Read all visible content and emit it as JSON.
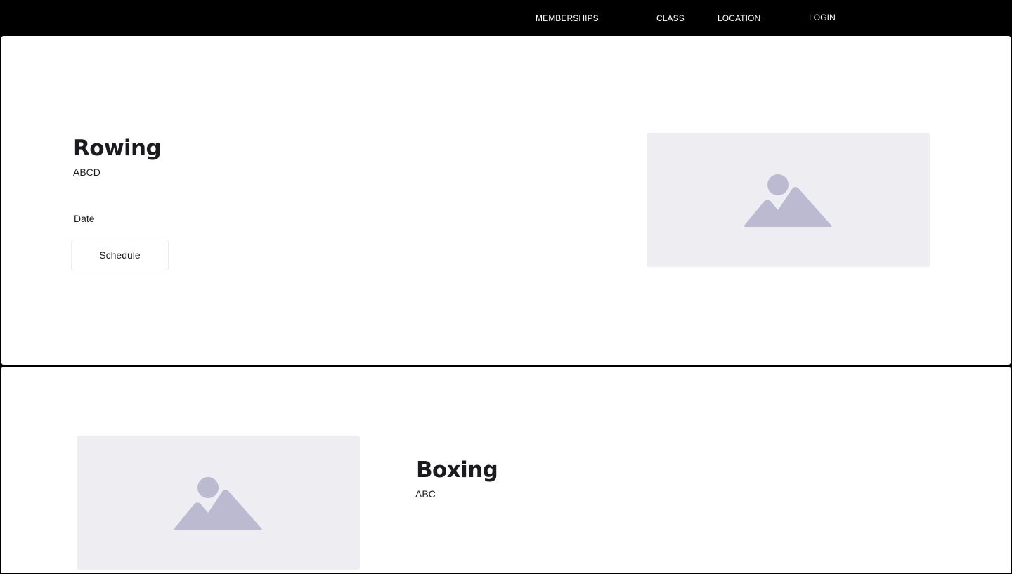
{
  "nav": {
    "items": [
      {
        "label": "MEMBERSHIPS"
      },
      {
        "label": "CLASS"
      },
      {
        "label": "LOCATION"
      },
      {
        "label": "LOGIN"
      }
    ]
  },
  "classes": [
    {
      "title": "Rowing",
      "description": "ABCD",
      "date_label": "Date",
      "button_label": "Schedule",
      "image_icon": "image-placeholder-icon"
    },
    {
      "title": "Boxing",
      "description": "ABC",
      "image_icon": "image-placeholder-icon"
    }
  ],
  "colors": {
    "navbar_bg": "#000000",
    "nav_text": "#ffffff",
    "card_bg": "#ffffff",
    "placeholder_bg": "#eeedf2",
    "placeholder_icon": "#bcbad1",
    "text": "#1b1b1f"
  }
}
